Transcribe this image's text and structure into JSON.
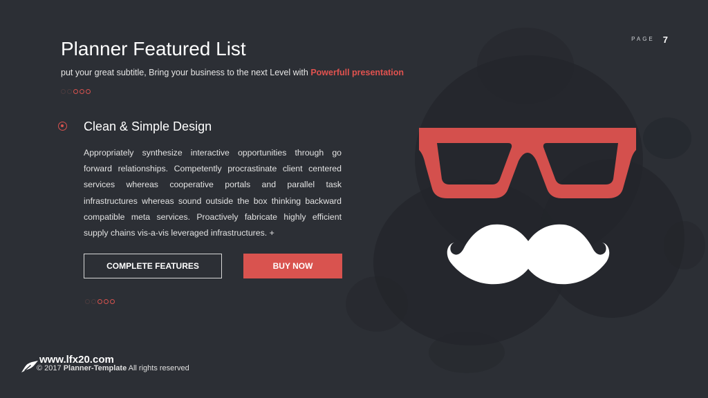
{
  "page": {
    "label": "PAGE",
    "number": "7"
  },
  "header": {
    "title": "Planner Featured List",
    "subtitle_plain": "put your great subtitle, Bring your business to the next Level with ",
    "subtitle_highlight": "Powerfull presentation"
  },
  "feature": {
    "heading": "Clean & Simple Design",
    "body": "Appropriately synthesize interactive opportunities through go forward relationships. Competently procrastinate client centered services whereas cooperative portals and parallel task infrastructures whereas sound outside the box thinking backward compatible meta services. Proactively fabricate highly efficient supply chains vis-a-vis leveraged infrastructures.  +"
  },
  "buttons": {
    "features_label": "COMPLETE FEATURES",
    "buy_label": "BUY NOW"
  },
  "footer": {
    "watermark": "www.lfx20.com",
    "prefix": "© 2017 ",
    "brand": "Planner-Template",
    "suffix": " All rights reserved"
  },
  "icons": [
    "ink-splatter-background",
    "glasses-icon",
    "mustache-icon",
    "pen-icon",
    "radio-bullet-icon"
  ],
  "colors": {
    "background": "#2c2f35",
    "accent": "#d9534f",
    "glasses": "#d4504d",
    "mustache": "#ffffff"
  }
}
